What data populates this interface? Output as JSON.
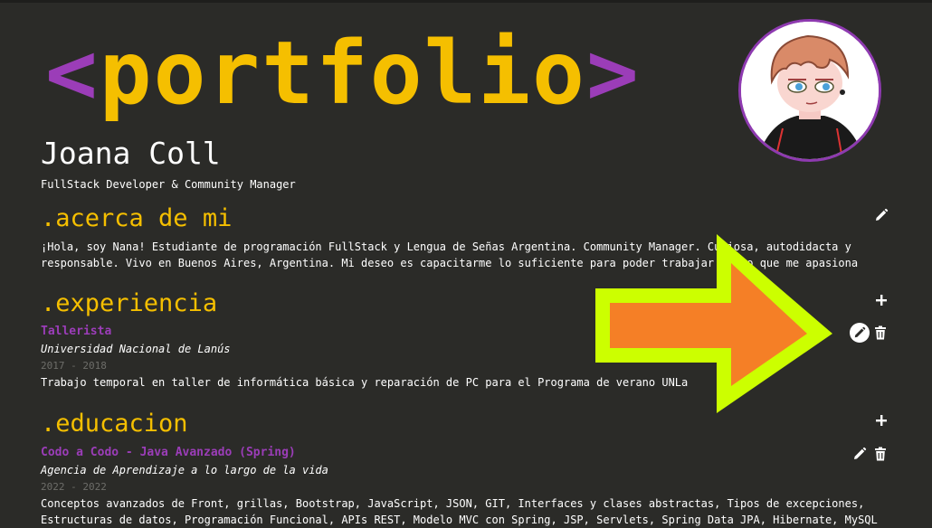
{
  "hero": {
    "open": "<",
    "word": "portfolio",
    "close": ">"
  },
  "profile": {
    "name": "Joana Coll",
    "subtitle": "FullStack Developer & Community Manager"
  },
  "about": {
    "title_dot": ".",
    "title": "acerca de mi",
    "text_line1": "¡Hola, soy Nana! Estudiante de programación FullStack y Lengua de Señas Argentina. Community Manager. Curiosa, autodidacta y",
    "text_line2": "responsable. Vivo en Buenos Aires, Argentina. Mi deseo es capacitarme lo suficiente para poder trabajar en lo que me apasiona"
  },
  "experience": {
    "title_dot": ".",
    "title": "experiencia",
    "items": [
      {
        "role": "Tallerista",
        "org": "Universidad Nacional de Lanús",
        "dates": "2017 - 2018",
        "description": "Trabajo temporal en taller de informática básica y reparación de PC para el Programa de verano UNLa"
      }
    ]
  },
  "education": {
    "title_dot": ".",
    "title": "educacion",
    "items": [
      {
        "course": "Codo a Codo - Java Avanzado (Spring)",
        "org": "Agencia de Aprendizaje a lo largo de la vida",
        "dates": "2022 - 2022",
        "description_line1": "Conceptos avanzados de Front, grillas, Bootstrap, JavaScript, JSON, GIT, Interfaces y clases abstractas, Tipos de excepciones,",
        "description_line2": "Estructuras de datos, Programación Funcional, APIs REST, Modelo MVC con Spring, JSP, Servlets, Spring Data JPA, Hibernate, MySQL"
      }
    ]
  },
  "icons": {
    "edit": "pencil-icon",
    "add": "plus-icon",
    "delete": "trash-icon"
  },
  "colors": {
    "background": "#2b2b28",
    "accent_yellow": "#f5bf00",
    "accent_purple": "#9b3db8",
    "arrow_fill": "#f57f26",
    "arrow_outline": "#ccff00"
  }
}
